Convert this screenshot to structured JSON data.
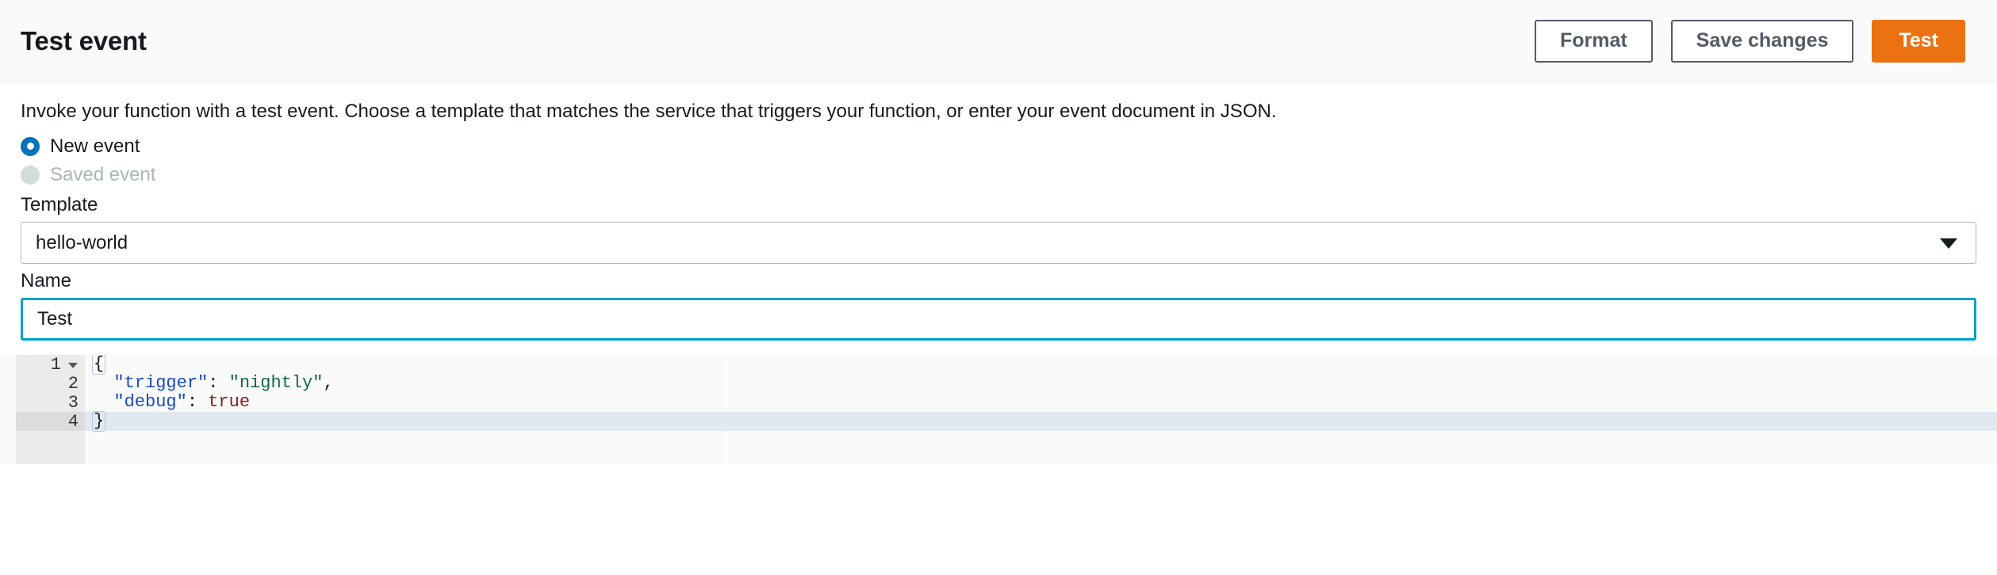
{
  "header": {
    "title": "Test event",
    "buttons": [
      {
        "label": "Format",
        "name": "format-button",
        "style": "normal"
      },
      {
        "label": "Save changes",
        "name": "save-changes-button",
        "style": "normal"
      },
      {
        "label": "Test",
        "name": "test-button",
        "style": "primary"
      }
    ]
  },
  "body": {
    "description": "Invoke your function with a test event. Choose a template that matches the service that triggers your function, or enter your event document in JSON.",
    "event_source": {
      "options": [
        {
          "label": "New event",
          "selected": true,
          "disabled": false
        },
        {
          "label": "Saved event",
          "selected": false,
          "disabled": true
        }
      ]
    },
    "template": {
      "label": "Template",
      "value": "hello-world",
      "arrow_icon": "chevron-down-icon"
    },
    "name": {
      "label": "Name",
      "value": "Test",
      "placeholder": "",
      "focused": true
    }
  },
  "editor": {
    "active_line": 4,
    "lines": [
      {
        "number": "1",
        "foldable": true,
        "tokens": [
          {
            "text": "{",
            "type": "punct",
            "brace_match": true
          }
        ]
      },
      {
        "number": "2",
        "foldable": false,
        "tokens": [
          {
            "text": "  ",
            "type": "punct"
          },
          {
            "text": "\"trigger\"",
            "type": "key"
          },
          {
            "text": ": ",
            "type": "punct"
          },
          {
            "text": "\"nightly\"",
            "type": "string"
          },
          {
            "text": ",",
            "type": "punct"
          }
        ]
      },
      {
        "number": "3",
        "foldable": false,
        "tokens": [
          {
            "text": "  ",
            "type": "punct"
          },
          {
            "text": "\"debug\"",
            "type": "key"
          },
          {
            "text": ": ",
            "type": "punct"
          },
          {
            "text": "true",
            "type": "bool"
          }
        ]
      },
      {
        "number": "4",
        "foldable": false,
        "tokens": [
          {
            "text": "}",
            "type": "punct",
            "brace_match": true
          }
        ]
      }
    ],
    "document_json": "{\n  \"trigger\": \"nightly\",\n  \"debug\": true\n}"
  },
  "colors": {
    "primary_button": "#ec7211",
    "radio_selected": "#0073bb",
    "input_focus_border": "#00a1c9",
    "header_background": "#fafafa",
    "editor_background": "#fafafa",
    "gutter_background": "#ebebeb",
    "active_line": "#e1e8f2",
    "key_token": "#1a4bbb",
    "string_token": "#116644",
    "boolean_token": "#8b1a1a"
  }
}
